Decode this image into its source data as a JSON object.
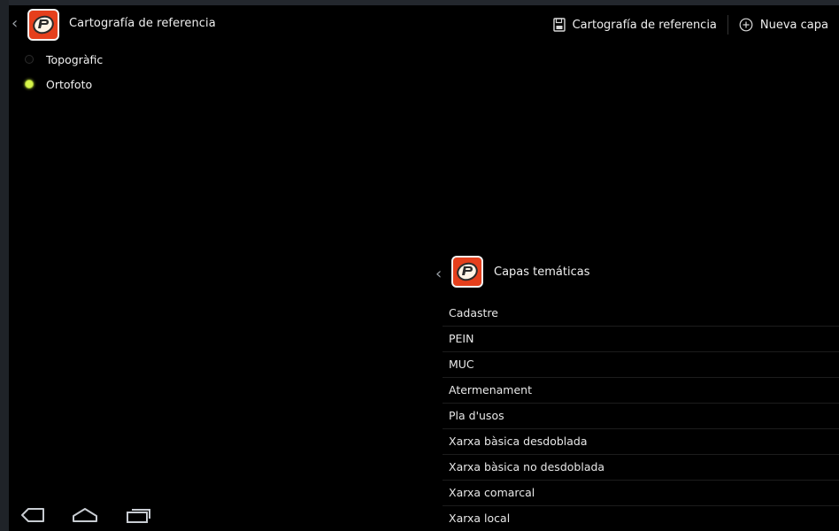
{
  "actionbar": {
    "back_glyph": "‹",
    "title": "Cartografía de referencia",
    "save_label": "Cartografía de referencia",
    "new_layer_label": "Nueva capa",
    "icons": {
      "save": "save-icon",
      "add": "add-circle-icon"
    }
  },
  "base_layers": {
    "options": [
      {
        "label": "Topogràfic",
        "selected": false
      },
      {
        "label": "Ortofoto",
        "selected": true
      }
    ]
  },
  "thematic_panel": {
    "back_glyph": "‹",
    "title": "Capas temáticas",
    "items": [
      "Cadastre",
      "PEIN",
      "MUC",
      "Atermenament",
      "Pla d'usos",
      "Xarxa bàsica desdoblada",
      "Xarxa bàsica no desdoblada",
      "Xarxa comarcal",
      "Xarxa local"
    ]
  },
  "navbar": {
    "icons": [
      "back-nav-icon",
      "home-nav-icon",
      "recent-apps-icon"
    ]
  },
  "colors": {
    "app_icon_bg": "#e53f1c",
    "radio_selected": "#d7f54a",
    "background": "#000000"
  }
}
